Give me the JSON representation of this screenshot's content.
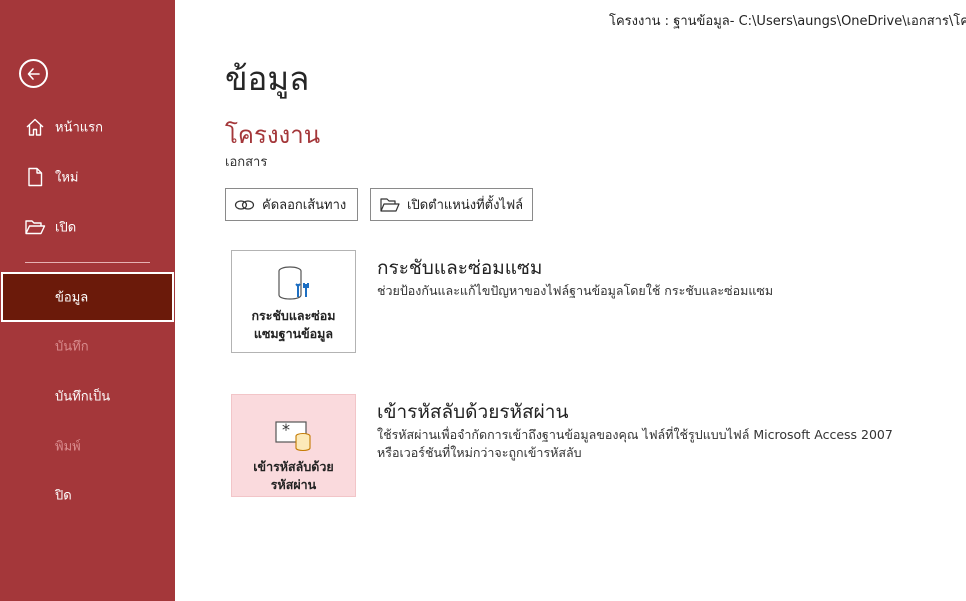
{
  "window": {
    "title": "โครงงาน : ฐานข้อมูล- C:\\Users\\aungs\\OneDrive\\เอกสาร\\โค"
  },
  "sidebar": {
    "back_icon": "back-arrow-circle-icon",
    "items": [
      {
        "label": "หน้าแรก",
        "icon": "home-icon",
        "state": "normal"
      },
      {
        "label": "ใหม่",
        "icon": "new-document-icon",
        "state": "normal"
      },
      {
        "label": "เปิด",
        "icon": "open-folder-icon",
        "state": "normal"
      },
      {
        "label": "ข้อมูล",
        "icon": "",
        "state": "active"
      },
      {
        "label": "บันทึก",
        "icon": "",
        "state": "disabled"
      },
      {
        "label": "บันทึกเป็น",
        "icon": "",
        "state": "normal"
      },
      {
        "label": "พิมพ์",
        "icon": "",
        "state": "disabled"
      },
      {
        "label": "ปิด",
        "icon": "",
        "state": "normal"
      }
    ]
  },
  "main": {
    "title": "ข้อมูล",
    "project_name": "โครงงาน",
    "project_location": "เอกสาร",
    "actions": {
      "copy_path": "คัดลอกเส้นทาง",
      "open_location": "เปิดตำแหน่งที่ตั้งไฟล์"
    },
    "compact_repair": {
      "tile_label_line1": "กระชับและซ่อม",
      "tile_label_line2": "แซมฐานข้อมูล",
      "heading": "กระชับและซ่อมแซม",
      "description": "ช่วยป้องกันและแก้ไขปัญหาของไฟล์ฐานข้อมูลโดยใช้ กระชับและซ่อมแซม"
    },
    "encrypt": {
      "tile_label_line1": "เข้ารหัสลับด้วย",
      "tile_label_line2": "รหัสผ่าน",
      "heading": "เข้ารหัสลับด้วยรหัสผ่าน",
      "description_line1": "ใช้รหัสผ่านเพื่อจำกัดการเข้าถึงฐานข้อมูลของคุณ ไฟล์ที่ใช้รูปแบบไฟล์ Microsoft Access 2007",
      "description_line2": "หรือเวอร์ชันที่ใหม่กว่าจะถูกเข้ารหัสลับ"
    }
  },
  "colors": {
    "sidebar_bg": "#a4373a",
    "sidebar_active_bg": "#6b1a0a",
    "accent_text": "#a4373a",
    "disabled_text": "#d98c8e",
    "encrypt_tile_bg": "#fadadd"
  }
}
